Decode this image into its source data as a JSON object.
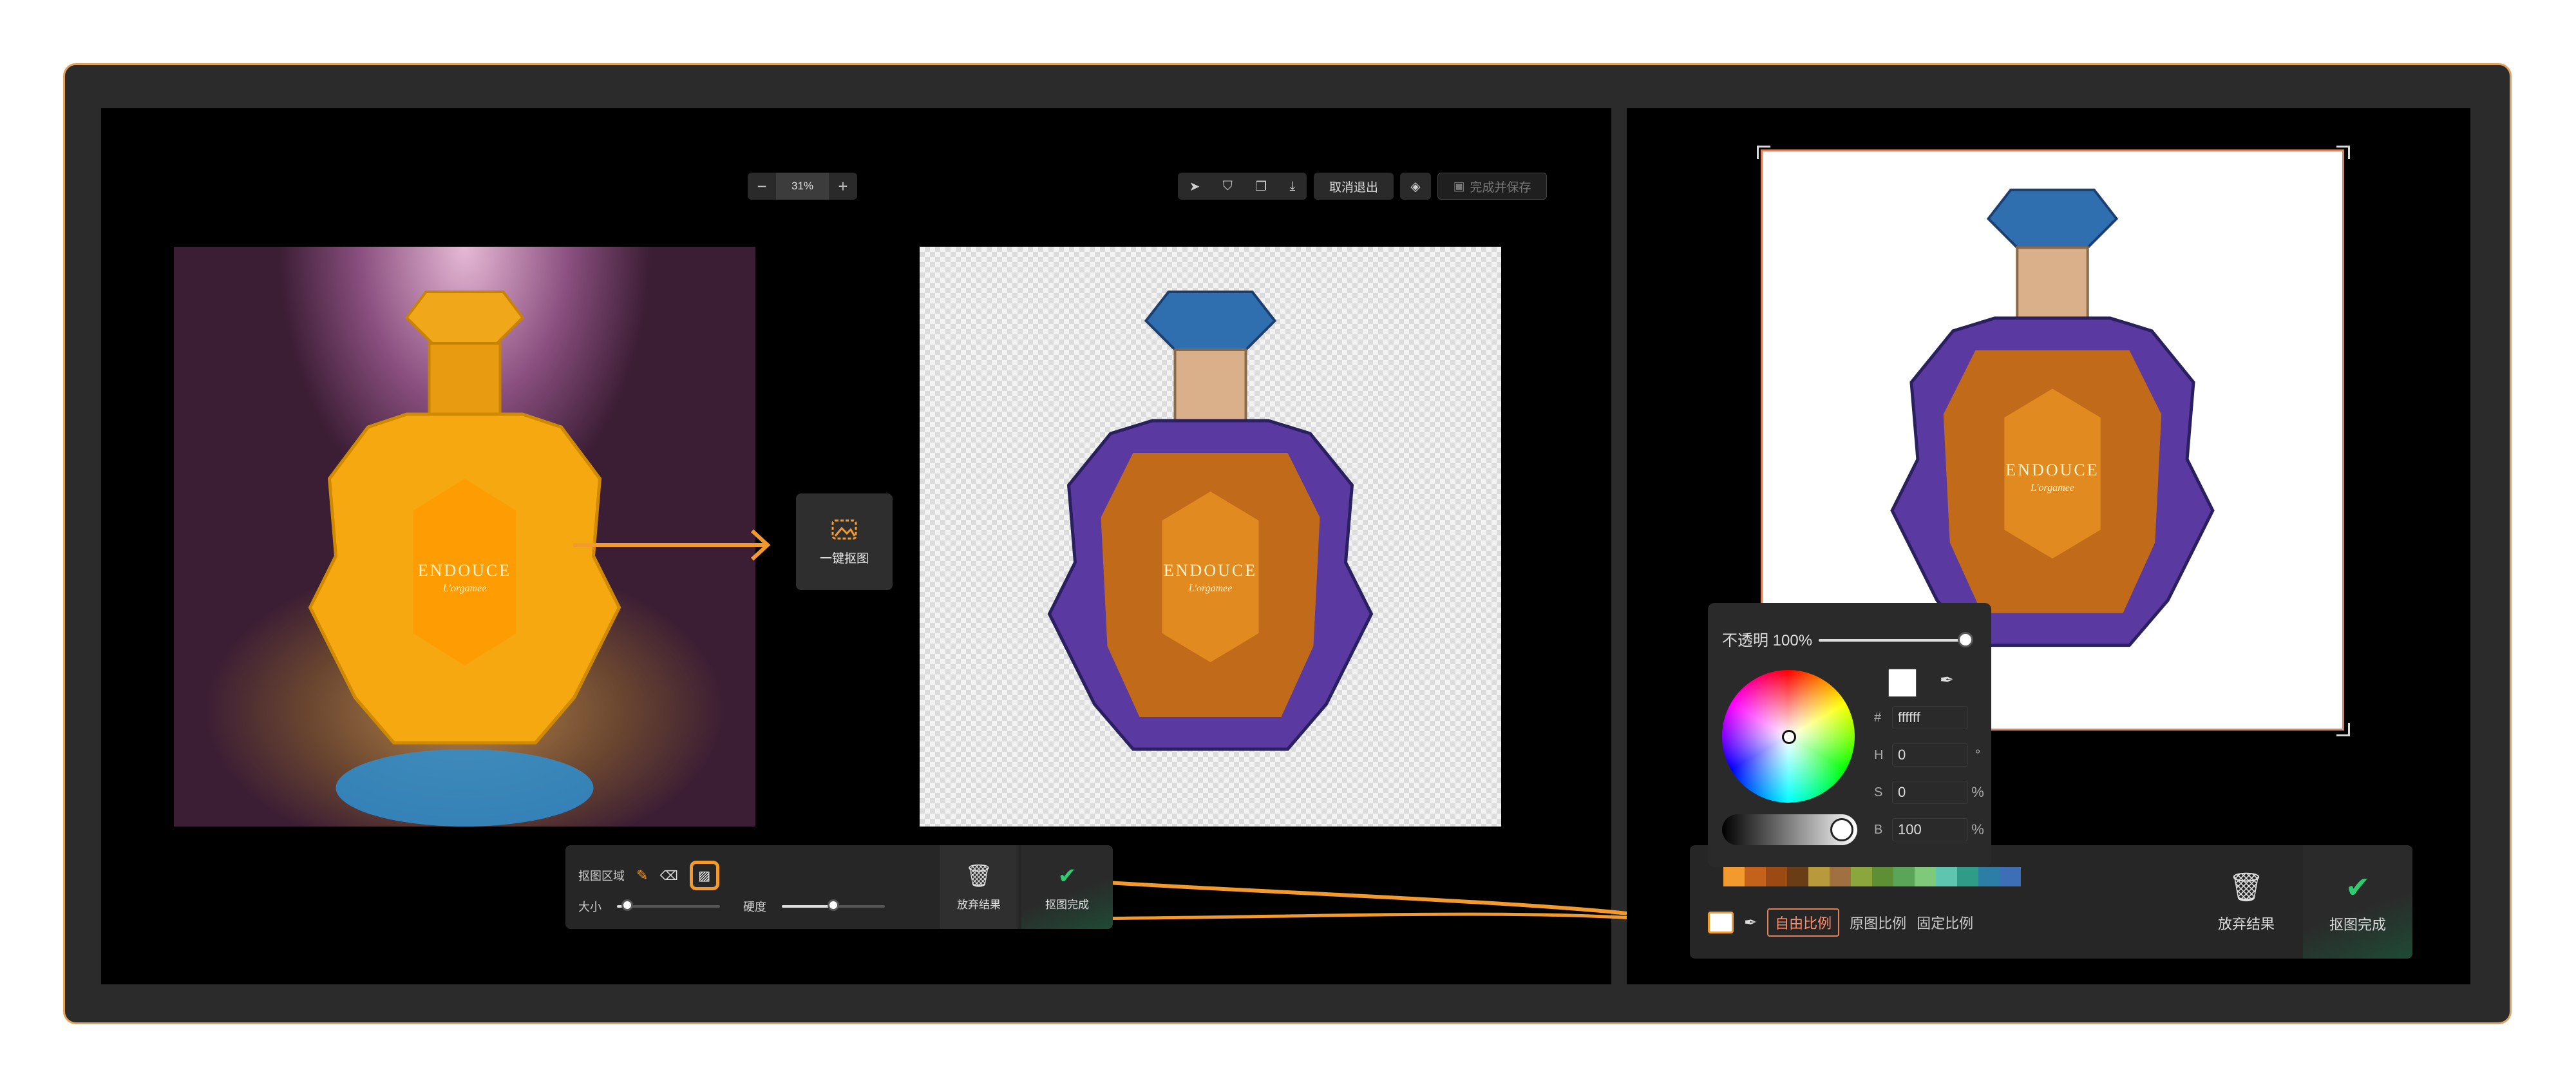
{
  "zoom": {
    "minus": "−",
    "value": "31%",
    "plus": "+"
  },
  "toolbar": {
    "cancel_label": "取消退出",
    "save_label": "完成并保存"
  },
  "one_click": {
    "label": "一键抠图"
  },
  "product": {
    "brand": "ENDOUCE",
    "subtitle": "L'orgamee"
  },
  "left_tools": {
    "area_label": "抠图区域",
    "size_label": "大小",
    "hardness_label": "硬度",
    "size_value": 0.05,
    "hardness_value": 0.5,
    "discard_label": "放弃结果",
    "done_label": "抠图完成"
  },
  "picker": {
    "opacity_label": "不透明 100%",
    "opacity_value": 1.0,
    "hex_key": "#",
    "hex_value": "ffffff",
    "h_key": "H",
    "h_value": "0",
    "h_unit": "°",
    "s_key": "S",
    "s_value": "0",
    "s_unit": "%",
    "b_key": "B",
    "b_value": "100",
    "b_unit": "%"
  },
  "swatch_colors": [
    "#f29a2e",
    "#c4611b",
    "#9a4a12",
    "#6b3d17",
    "#b89a3d",
    "#a07040",
    "#8aa63d",
    "#5e8f35",
    "#5aa558",
    "#7fc97a",
    "#5ec6b0",
    "#2e9c86",
    "#2d7ea6",
    "#3c6fb6"
  ],
  "right_tools": {
    "ratio_free": "自由比例",
    "ratio_original": "原图比例",
    "ratio_fixed": "固定比例",
    "discard_label": "放弃结果",
    "done_label": "抠图完成"
  },
  "colors": {
    "accent": "#f29a2e",
    "frame": "#e0a25c",
    "success": "#2ecc71"
  }
}
